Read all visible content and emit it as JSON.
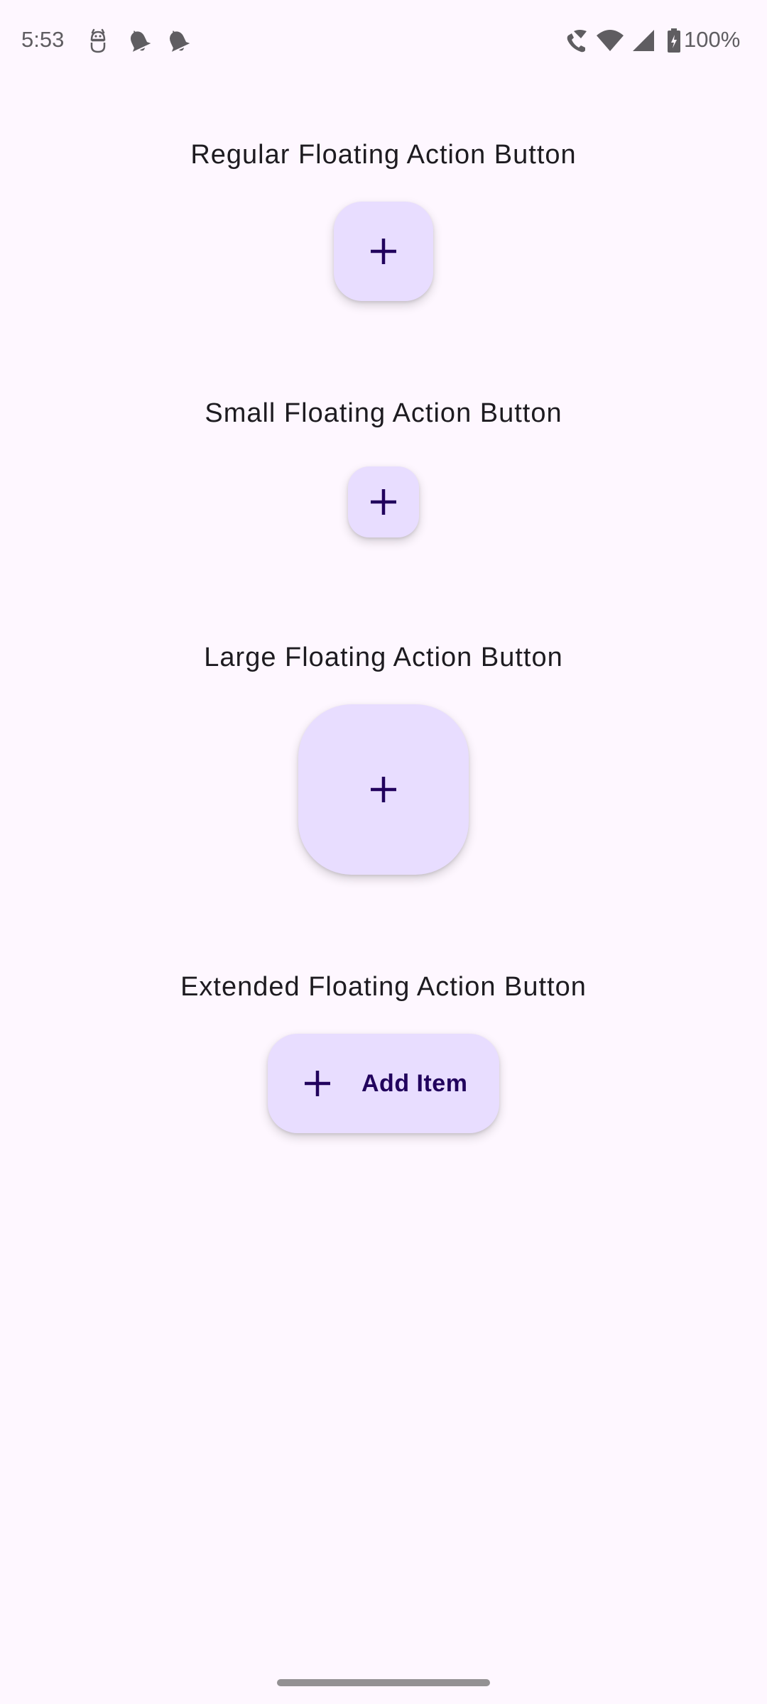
{
  "status_bar": {
    "time": "5:53",
    "left_icons": [
      "android-debug-icon",
      "notification-bell-icon",
      "notification-bell-icon"
    ],
    "right_icons": [
      "wifi-calling-icon",
      "wifi-icon",
      "cellular-signal-icon",
      "battery-charging-icon"
    ],
    "battery_percent": "100%"
  },
  "sections": [
    {
      "title": "Regular Floating Action Button",
      "fab_type": "regular",
      "icon": "plus-icon"
    },
    {
      "title": "Small Floating Action Button",
      "fab_type": "small",
      "icon": "plus-icon"
    },
    {
      "title": "Large Floating Action Button",
      "fab_type": "large",
      "icon": "plus-icon"
    },
    {
      "title": "Extended Floating Action Button",
      "fab_type": "extended",
      "icon": "plus-icon",
      "label": "Add Item"
    }
  ],
  "colors": {
    "background": "#fef7ff",
    "fab_container": "#e8ddff",
    "fab_content": "#21005d",
    "title_text": "#1d1b20",
    "status_icons": "#5f5d61",
    "home_indicator": "#939193"
  }
}
